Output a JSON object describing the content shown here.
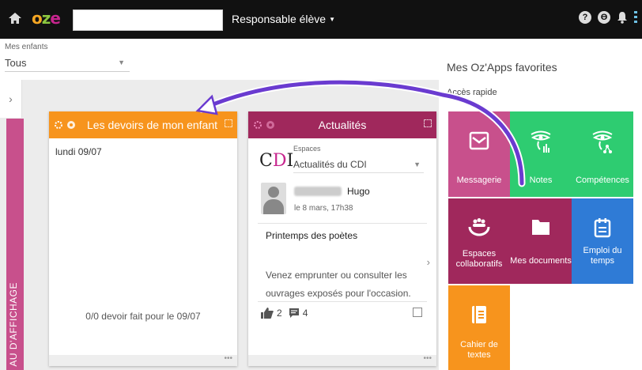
{
  "topbar": {
    "logo": {
      "o": "o",
      "z": "z",
      "e": "e"
    },
    "role": "Responsable élève",
    "help": "?",
    "account": "ϴ"
  },
  "children": {
    "label": "Mes enfants",
    "selected": "Tous"
  },
  "vertical_label": "AU D'AFFICHAGE",
  "homework": {
    "title": "Les devoirs de mon enfant",
    "date": "lundi 09/07",
    "status": "0/0 devoir fait pour le 09/07",
    "more": "•••"
  },
  "news": {
    "title": "Actualités",
    "space_label": "Espaces",
    "space_value": "Actualités du CDI",
    "author": "Hugo",
    "post_date": "le 8 mars, 17h38",
    "post_title": "Printemps des poètes",
    "post_body": "Venez emprunter ou consulter les ouvrages exposés pour l'occasion.",
    "likes": "2",
    "comments": "4",
    "more": "•••",
    "logo": {
      "c": "C",
      "d": "D",
      "i": "I"
    }
  },
  "apps": {
    "title": "Mes Oz'Apps favorites",
    "quick_access": "Accès rapide",
    "tiles": [
      {
        "label": "Messagerie",
        "icon": "envelope-icon",
        "color": "#c8508c"
      },
      {
        "label": "Notes",
        "icon": "eye-chart-icon",
        "color": "#2ecc71"
      },
      {
        "label": "Compétences",
        "icon": "eye-network-icon",
        "color": "#2ecc71"
      },
      {
        "label": "Espaces collaboratifs",
        "icon": "group-icon",
        "color": "#a0285c"
      },
      {
        "label": "Mes documents",
        "icon": "folder-icon",
        "color": "#a0285c"
      },
      {
        "label": "Emploi du temps",
        "icon": "calendar-icon",
        "color": "#2f7bd6"
      },
      {
        "label": "Cahier de textes",
        "icon": "notebook-icon",
        "color": "#f7941d"
      }
    ]
  },
  "colors": {
    "topbar": "#111111",
    "homework_header": "#f7941d",
    "news_header": "#a0285c",
    "annotation_arrow": "#6a3bd0"
  }
}
